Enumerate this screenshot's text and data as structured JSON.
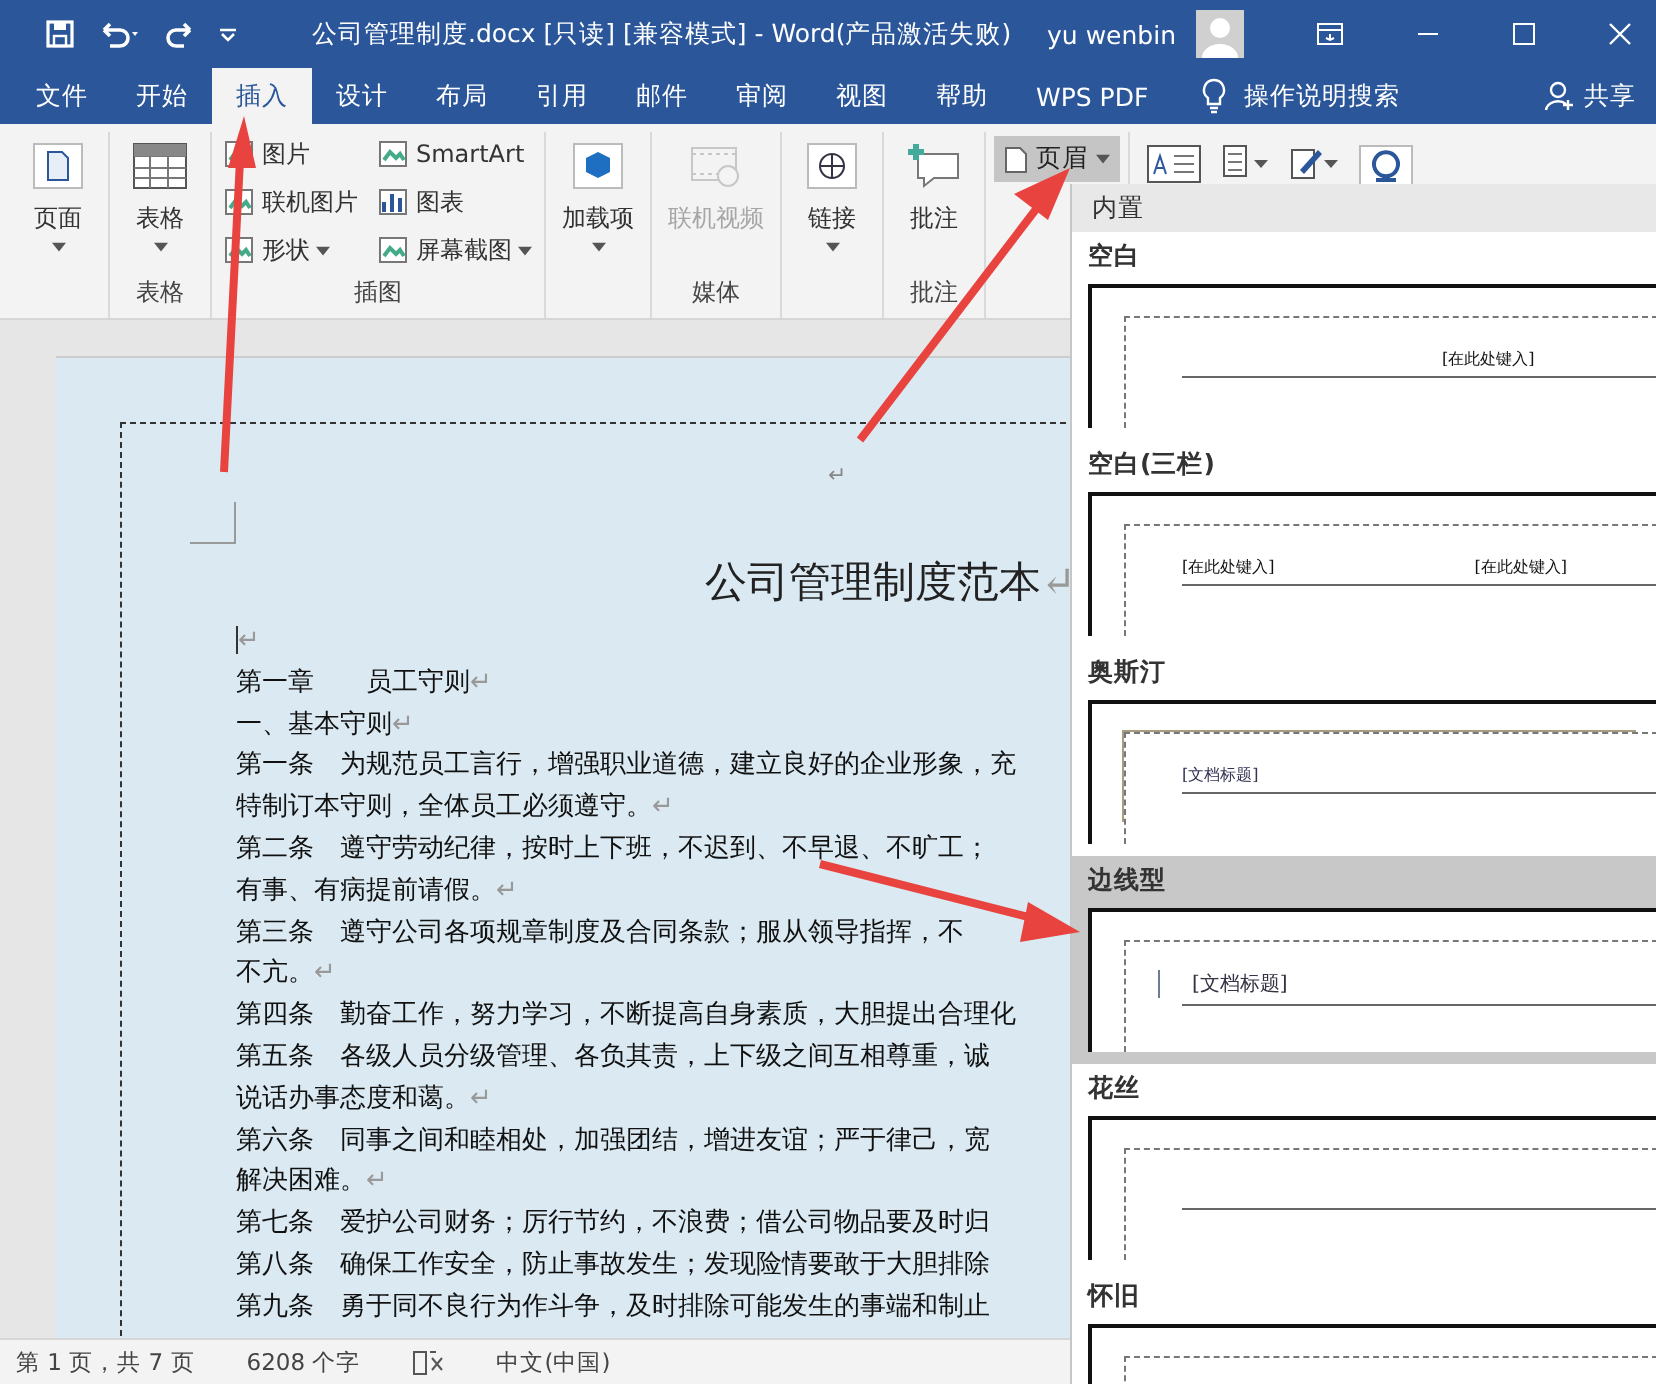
{
  "window": {
    "title": "公司管理制度.docx [只读] [兼容模式]  -  Word(产品激活失败)",
    "user": "yu wenbin"
  },
  "tabs": [
    {
      "label": "文件",
      "selected": false
    },
    {
      "label": "开始",
      "selected": false
    },
    {
      "label": "插入",
      "selected": true
    },
    {
      "label": "设计",
      "selected": false
    },
    {
      "label": "布局",
      "selected": false
    },
    {
      "label": "引用",
      "selected": false
    },
    {
      "label": "邮件",
      "selected": false
    },
    {
      "label": "审阅",
      "selected": false
    },
    {
      "label": "视图",
      "selected": false
    },
    {
      "label": "帮助",
      "selected": false
    },
    {
      "label": "WPS PDF",
      "selected": false
    }
  ],
  "tell_me": "操作说明搜索",
  "share": "共享",
  "ribbon": {
    "groups": [
      {
        "items": [
          {
            "kind": "large",
            "label": "页面",
            "dropdown": true,
            "disabled": false
          }
        ]
      },
      {
        "label": "表格",
        "items": [
          {
            "kind": "large",
            "label": "表格",
            "dropdown": true,
            "disabled": false
          }
        ]
      },
      {
        "label": "插图",
        "items": [
          {
            "kind": "small",
            "label": "图片",
            "dropdown": false,
            "disabled": false
          },
          {
            "kind": "small",
            "label": "联机图片",
            "dropdown": false,
            "disabled": false
          },
          {
            "kind": "small",
            "label": "形状",
            "dropdown": true,
            "disabled": false
          },
          {
            "kind": "small",
            "label": "SmartArt",
            "dropdown": false,
            "disabled": false
          },
          {
            "kind": "small",
            "label": "图表",
            "dropdown": false,
            "disabled": false
          },
          {
            "kind": "small",
            "label": "屏幕截图",
            "dropdown": true,
            "disabled": false
          }
        ]
      },
      {
        "items": [
          {
            "kind": "large",
            "label": "加载项",
            "dropdown": true,
            "disabled": false
          }
        ]
      },
      {
        "label": "媒体",
        "items": [
          {
            "kind": "large",
            "label": "联机视频",
            "dropdown": false,
            "disabled": true
          }
        ]
      },
      {
        "items": [
          {
            "kind": "large",
            "label": "链接",
            "dropdown": true,
            "disabled": false
          }
        ]
      },
      {
        "label": "批注",
        "items": [
          {
            "kind": "large",
            "label": "批注",
            "dropdown": false,
            "disabled": false
          }
        ]
      },
      {
        "items": [
          {
            "kind": "header",
            "label": "页眉",
            "dropdown": true,
            "disabled": false,
            "selected": true
          }
        ]
      }
    ]
  },
  "document": {
    "header_mark": "↵",
    "title": "公司管理制度范本",
    "title_mark": "↵",
    "cursor_mark": "↵",
    "lines": [
      {
        "text": "第一章　　员工守则",
        "mark": "↵"
      },
      {
        "text": "一、基本守则",
        "mark": "↵"
      },
      {
        "text": "第一条　为规范员工言行，增强职业道德，建立良好的企业形象，充"
      },
      {
        "text": "特制订本守则，全体员工必须遵守。",
        "mark": "↵"
      },
      {
        "text": "第二条　遵守劳动纪律，按时上下班，不迟到、不早退、不旷工；"
      },
      {
        "text": "有事、有病提前请假。",
        "mark": "↵"
      },
      {
        "text": "第三条　遵守公司各项规章制度及合同条款；服从领导指挥，不"
      },
      {
        "text": "不亢。",
        "mark": "↵"
      },
      {
        "text": "第四条　勤奋工作，努力学习，不断提高自身素质，大胆提出合理化"
      },
      {
        "text": "第五条　各级人员分级管理、各负其责，上下级之间互相尊重，诚"
      },
      {
        "text": "说话办事态度和蔼。",
        "mark": "↵"
      },
      {
        "text": "第六条　同事之间和睦相处，加强团结，增进友谊；严于律己，宽"
      },
      {
        "text": "解决困难。",
        "mark": "↵"
      },
      {
        "text": "第七条　爱护公司财务；厉行节约，不浪费；借公司物品要及时归"
      },
      {
        "text": "第八条　确保工作安全，防止事故发生；发现险情要敢于大胆排除"
      },
      {
        "text": "第九条　勇于同不良行为作斗争，及时排除可能发生的事端和制止"
      }
    ]
  },
  "header_gallery": {
    "section": "内置",
    "items": [
      {
        "label": "空白",
        "kind": "center",
        "texts": [
          "[在此处键入]"
        ],
        "selected": false
      },
      {
        "label": "空白(三栏)",
        "kind": "three",
        "texts": [
          "[在此处键入]",
          "[在此处键入]"
        ],
        "selected": false
      },
      {
        "label": "奥斯汀",
        "kind": "austin",
        "texts": [
          "[文档标题]"
        ],
        "selected": false
      },
      {
        "label": "边线型",
        "kind": "sideline",
        "texts": [
          "[文档标题]"
        ],
        "selected": true
      },
      {
        "label": "花丝",
        "kind": "filigree",
        "selected": false
      },
      {
        "label": "怀旧",
        "kind": "retro",
        "selected": false
      }
    ]
  },
  "status_bar": {
    "page": "第 1 页，共 7 页",
    "words": "6208 个字",
    "language": "中文(中国)"
  }
}
